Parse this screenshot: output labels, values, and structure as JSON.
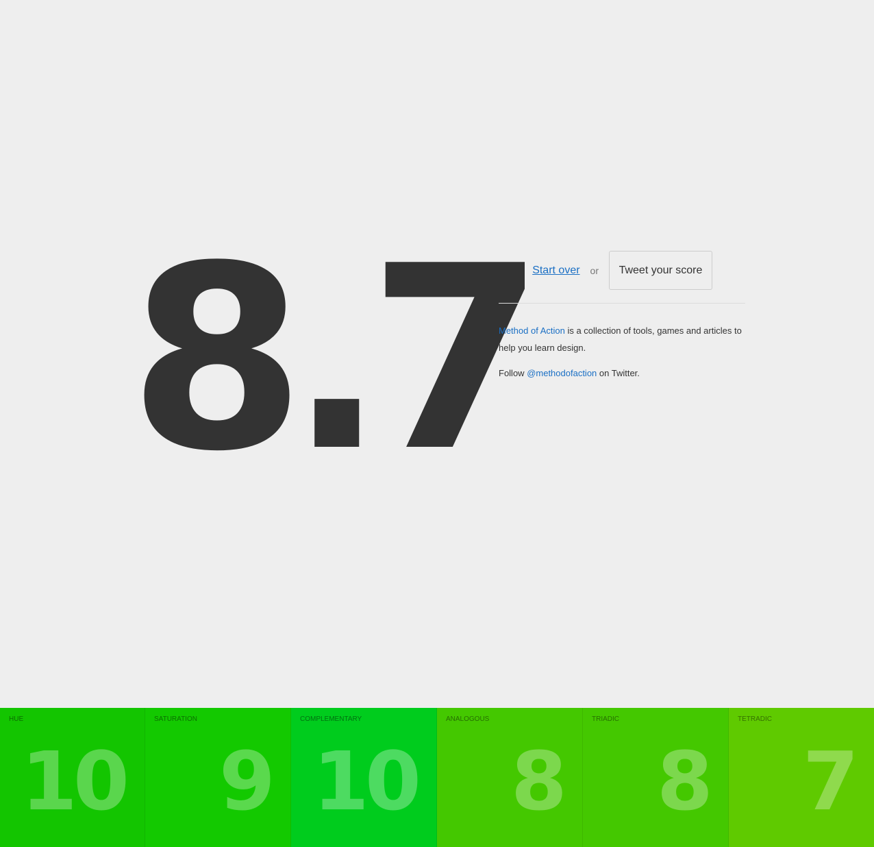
{
  "result": {
    "score": "8.7"
  },
  "actions": {
    "start_over": "Start over",
    "or": "or",
    "tweet": "Tweet your score"
  },
  "about": {
    "brand_link": "Method of Action",
    "text": " is a collection of tools, games and articles to help you learn design."
  },
  "follow": {
    "prefix": "Follow ",
    "handle": "@methodofaction",
    "suffix": " on Twitter."
  },
  "categories": [
    {
      "label": "HUE",
      "score": "10",
      "color": "#13c500"
    },
    {
      "label": "SATURATION",
      "score": "9",
      "color": "#13c900"
    },
    {
      "label": "COMPLEMENTARY",
      "score": "10",
      "color": "#00cc1d"
    },
    {
      "label": "ANALOGOUS",
      "score": "8",
      "color": "#44c800"
    },
    {
      "label": "TRIADIC",
      "score": "8",
      "color": "#44c800"
    },
    {
      "label": "TETRADIC",
      "score": "7",
      "color": "#5fca00"
    }
  ]
}
